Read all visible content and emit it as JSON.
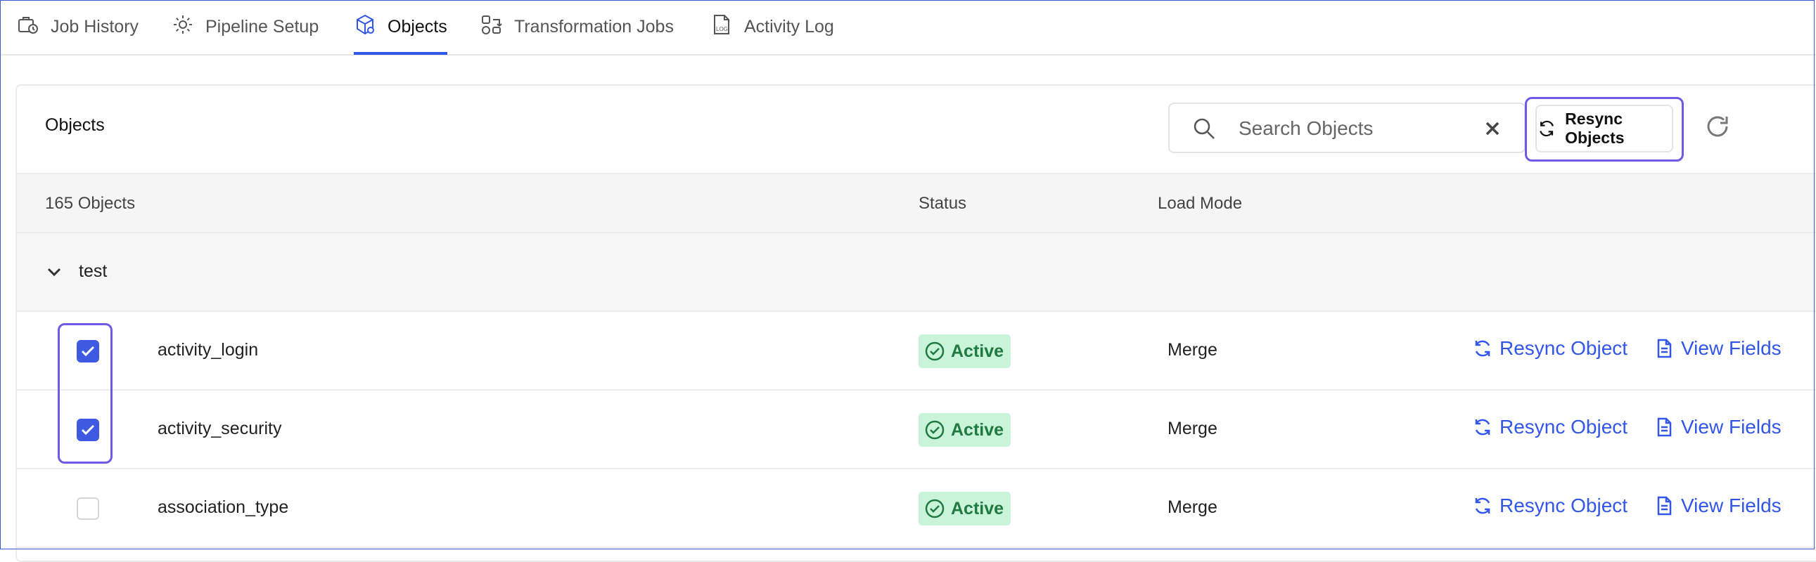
{
  "tabs": [
    {
      "label": "Job History",
      "icon": "briefcase-clock-icon",
      "active": false
    },
    {
      "label": "Pipeline Setup",
      "icon": "gear-icon",
      "active": false
    },
    {
      "label": "Objects",
      "icon": "cube-icon",
      "active": true
    },
    {
      "label": "Transformation Jobs",
      "icon": "transform-icon",
      "active": false
    },
    {
      "label": "Activity Log",
      "icon": "log-file-icon",
      "active": false
    }
  ],
  "panel": {
    "title": "Objects",
    "search_placeholder": "Search Objects",
    "resync_objects_label": "Resync Objects"
  },
  "table": {
    "headers": {
      "objects": "165 Objects",
      "status": "Status",
      "load_mode": "Load Mode"
    },
    "group": {
      "name": "test",
      "expanded": true
    },
    "rows": [
      {
        "name": "activity_login",
        "checked": true,
        "status": "Active",
        "load_mode": "Merge",
        "resync_label": "Resync Object",
        "view_label": "View Fields"
      },
      {
        "name": "activity_security",
        "checked": true,
        "status": "Active",
        "load_mode": "Merge",
        "resync_label": "Resync Object",
        "view_label": "View Fields"
      },
      {
        "name": "association_type",
        "checked": false,
        "status": "Active",
        "load_mode": "Merge",
        "resync_label": "Resync Object",
        "view_label": "View Fields"
      }
    ]
  },
  "colors": {
    "accent": "#3156e8",
    "selection_outline": "#6d5ae6",
    "status_bg": "#c9f4d9",
    "status_text": "#1f7a3f"
  }
}
